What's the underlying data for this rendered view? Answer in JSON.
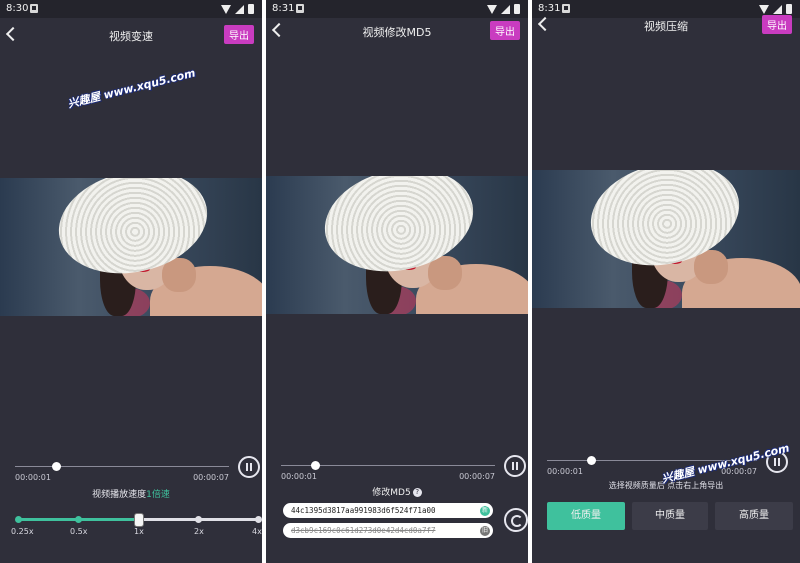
{
  "watermark_text": "兴趣屋 www.xqu5.com",
  "screens": [
    {
      "status": {
        "time": "8:30"
      },
      "header": {
        "title": "视频变速",
        "export_label": "导出"
      },
      "player": {
        "current_time": "00:00:01",
        "total_time": "00:00:07"
      },
      "speed": {
        "label_prefix": "视频播放速度",
        "label_value": "1倍速",
        "ticks": [
          "0.25x",
          "0.5x",
          "1x",
          "2x",
          "4x"
        ],
        "selected_index": 2
      }
    },
    {
      "status": {
        "time": "8:31"
      },
      "header": {
        "title": "视频修改MD5",
        "export_label": "导出"
      },
      "player": {
        "current_time": "00:00:01",
        "total_time": "00:00:07"
      },
      "md5": {
        "label": "修改MD5",
        "help_icon": "?",
        "new_value": "44c1395d3817aa991983d6f524f71a00",
        "new_tag": "新",
        "old_value": "d3cb9c169c0c61d273d0e42d4cd0a7f7",
        "old_tag": "旧"
      }
    },
    {
      "status": {
        "time": "8:31"
      },
      "header": {
        "title": "视频压缩",
        "export_label": "导出"
      },
      "player": {
        "current_time": "00:00:01",
        "total_time": "00:00:07"
      },
      "quality": {
        "hint": "选择视频质量后 点击右上角导出",
        "options": [
          "低质量",
          "中质量",
          "高质量"
        ],
        "selected_index": 0
      }
    }
  ],
  "colors": {
    "accent": "#3fc19d",
    "export": "#c93cc0",
    "background": "#2f2f3a"
  }
}
